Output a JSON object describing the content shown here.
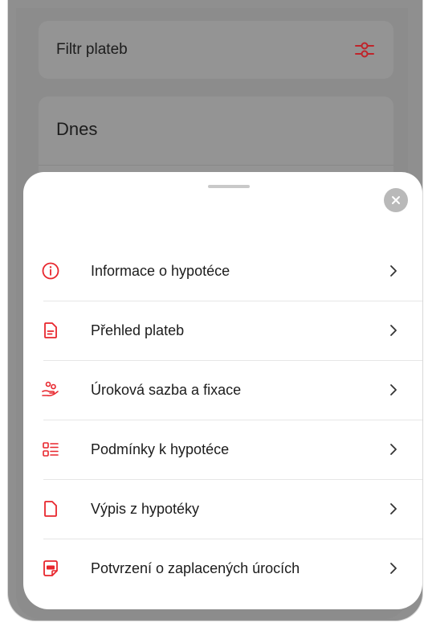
{
  "background": {
    "filter_label": "Filtr plateb",
    "today_title": "Dnes"
  },
  "sheet": {
    "items": [
      {
        "label": "Informace o hypotéce",
        "icon": "info-circle-icon"
      },
      {
        "label": "Přehled plateb",
        "icon": "document-list-icon"
      },
      {
        "label": "Úroková sazba a fixace",
        "icon": "hand-coins-icon"
      },
      {
        "label": "Podmínky k hypotéce",
        "icon": "checklist-icon"
      },
      {
        "label": "Výpis z hypotéky",
        "icon": "document-icon"
      },
      {
        "label": "Potvrzení o zaplacených úrocích",
        "icon": "pdf-icon"
      }
    ]
  },
  "colors": {
    "accent": "#e8262d",
    "overlay": "#8c8c8c",
    "sheet": "#ffffff"
  }
}
